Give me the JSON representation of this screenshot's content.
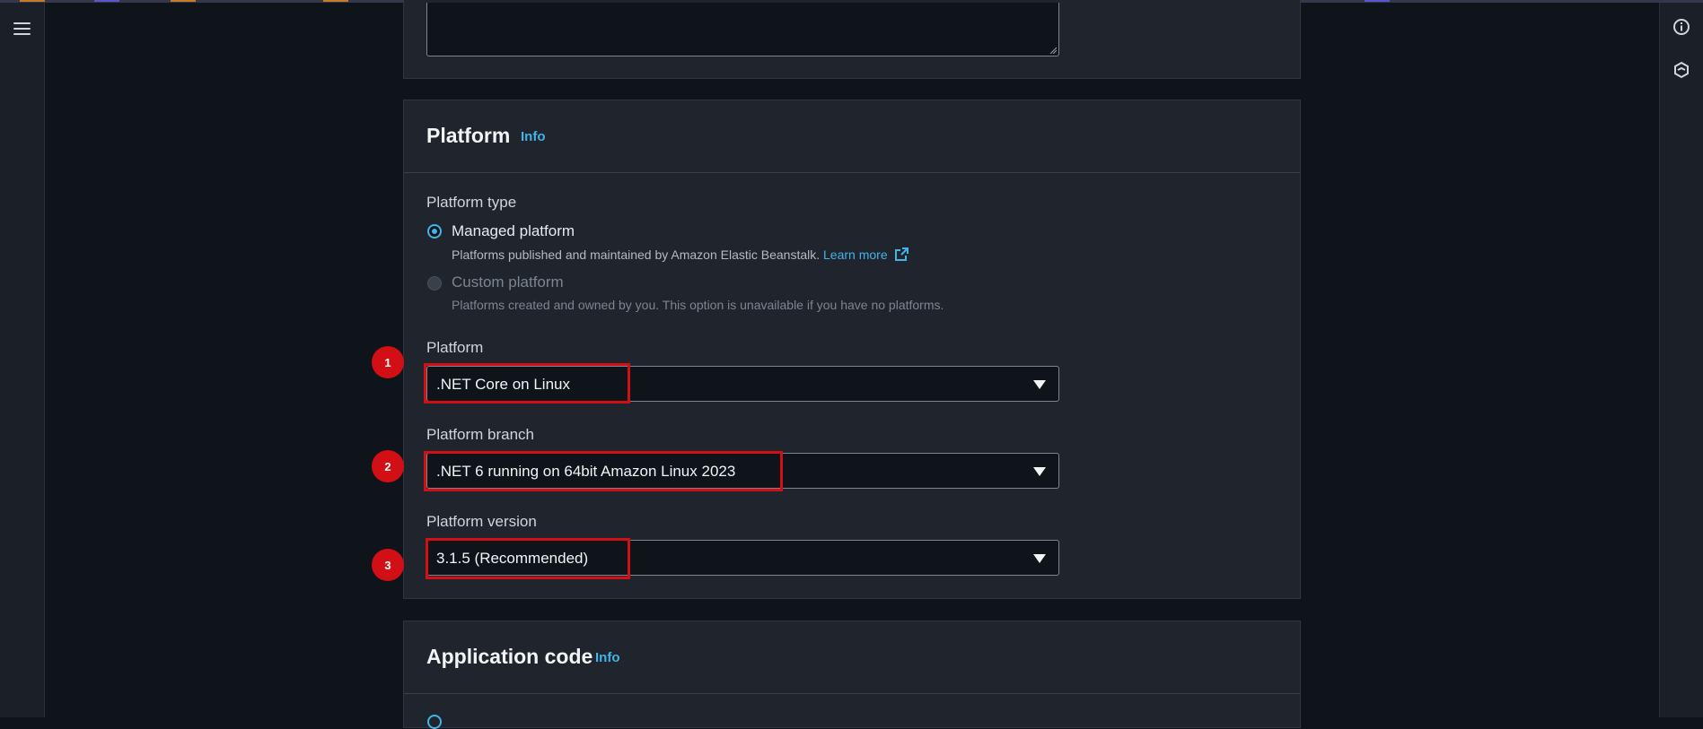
{
  "platform_section": {
    "title": "Platform",
    "info_label": "Info",
    "platform_type_label": "Platform type",
    "managed": {
      "label": "Managed platform",
      "description": "Platforms published and maintained by Amazon Elastic Beanstalk.",
      "learn_more": "Learn more"
    },
    "custom": {
      "label": "Custom platform",
      "description": "Platforms created and owned by you. This option is unavailable if you have no platforms."
    },
    "platform": {
      "label": "Platform",
      "value": ".NET Core on Linux"
    },
    "branch": {
      "label": "Platform branch",
      "value": ".NET 6 running on 64bit Amazon Linux 2023"
    },
    "version": {
      "label": "Platform version",
      "value": "3.1.5 (Recommended)"
    }
  },
  "app_code_section": {
    "title": "Application code",
    "info_label": "Info"
  },
  "markers": [
    "1",
    "2",
    "3"
  ],
  "colors": {
    "accent": "#42b4e8",
    "highlight": "#d20f14",
    "background": "#0f141a",
    "panel": "#1f242d"
  },
  "icons": [
    "menu-icon",
    "info-circle-icon",
    "cube-icon",
    "external-link-icon"
  ]
}
